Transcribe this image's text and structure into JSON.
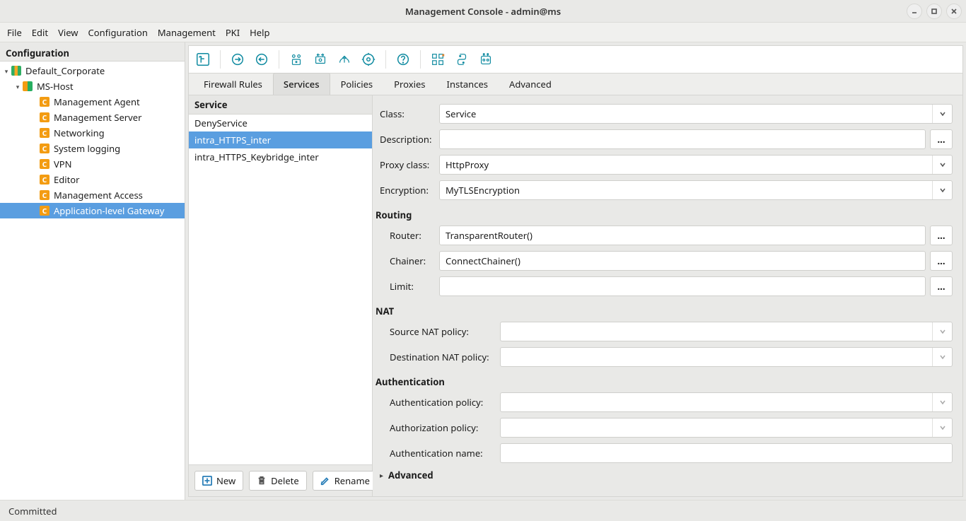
{
  "window_title": "Management Console - admin@ms",
  "menu": [
    "File",
    "Edit",
    "View",
    "Configuration",
    "Management",
    "PKI",
    "Help"
  ],
  "sidebar": {
    "header": "Configuration",
    "site": "Default_Corporate",
    "host": "MS-Host",
    "components": [
      "Management Agent",
      "Management Server",
      "Networking",
      "System logging",
      "VPN",
      "Editor",
      "Management Access",
      "Application-level Gateway"
    ],
    "selected_index": 7
  },
  "tabs": [
    "Firewall Rules",
    "Services",
    "Policies",
    "Proxies",
    "Instances",
    "Advanced"
  ],
  "active_tab": 1,
  "services": {
    "header": "Service",
    "items": [
      "DenyService",
      "intra_HTTPS_inter",
      "intra_HTTPS_Keybridge_inter"
    ],
    "selected_index": 1
  },
  "detail": {
    "class_label": "Class:",
    "class_value": "Service",
    "description_label": "Description:",
    "description_value": "",
    "proxy_class_label": "Proxy class:",
    "proxy_class_value": "HttpProxy",
    "encryption_label": "Encryption:",
    "encryption_value": "MyTLSEncryption",
    "routing_section": "Routing",
    "router_label": "Router:",
    "router_value": "TransparentRouter()",
    "chainer_label": "Chainer:",
    "chainer_value": "ConnectChainer()",
    "limit_label": "Limit:",
    "limit_value": "",
    "nat_section": "NAT",
    "snat_label": "Source NAT policy:",
    "snat_value": "",
    "dnat_label": "Destination NAT policy:",
    "dnat_value": "",
    "auth_section": "Authentication",
    "authn_policy_label": "Authentication policy:",
    "authn_policy_value": "",
    "authz_policy_label": "Authorization policy:",
    "authz_policy_value": "",
    "authn_name_label": "Authentication name:",
    "authn_name_value": "",
    "advanced_expander": "Advanced"
  },
  "buttons": {
    "new": "New",
    "delete": "Delete",
    "rename": "Rename",
    "ellipsis": "..."
  },
  "statusbar": "Committed",
  "toolbar_names": [
    "view-hierarchy",
    "commit",
    "revert",
    "validate-workflow",
    "sync-config",
    "upload",
    "refresh-config",
    "help",
    "modules",
    "scripting",
    "robot"
  ]
}
